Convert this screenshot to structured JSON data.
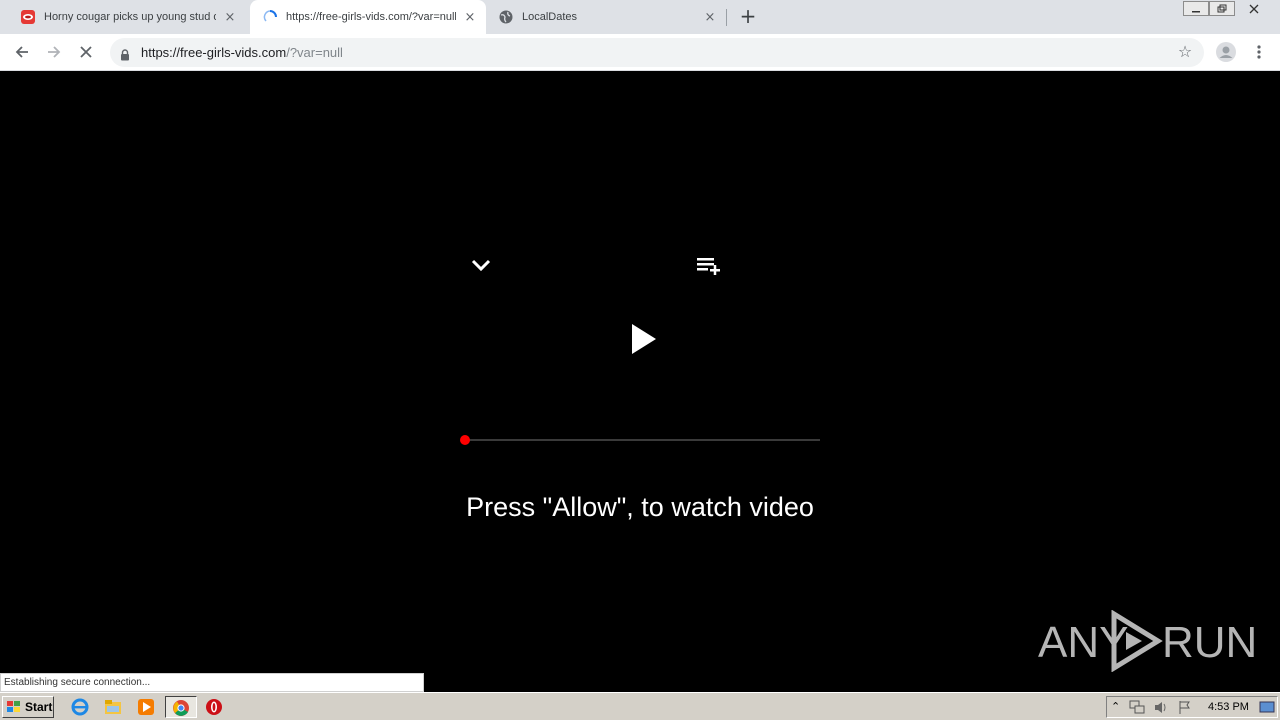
{
  "tabs": [
    {
      "title": "Horny cougar picks up young stud on",
      "favicon": "red-lips-icon",
      "close": "×"
    },
    {
      "title": "https://free-girls-vids.com/?var=null",
      "favicon": "loading-spinner-icon",
      "close": "×"
    },
    {
      "title": "LocalDates",
      "favicon": "globe-icon",
      "close": "×"
    }
  ],
  "toolbar": {
    "url_host": "https://free-girls-vids.com",
    "url_rest": "/?var=null"
  },
  "page": {
    "cta_text": "Press \"Allow\", to watch video",
    "progress": 0
  },
  "status_text": "Establishing secure connection...",
  "watermark": {
    "left": "ANY",
    "right": "RUN"
  },
  "taskbar": {
    "start_label": "Start",
    "clock": "4:53 PM"
  },
  "colors": {
    "accent_red": "#ff0000",
    "tab_strip": "#dee1e6",
    "page_bg": "#000000"
  }
}
